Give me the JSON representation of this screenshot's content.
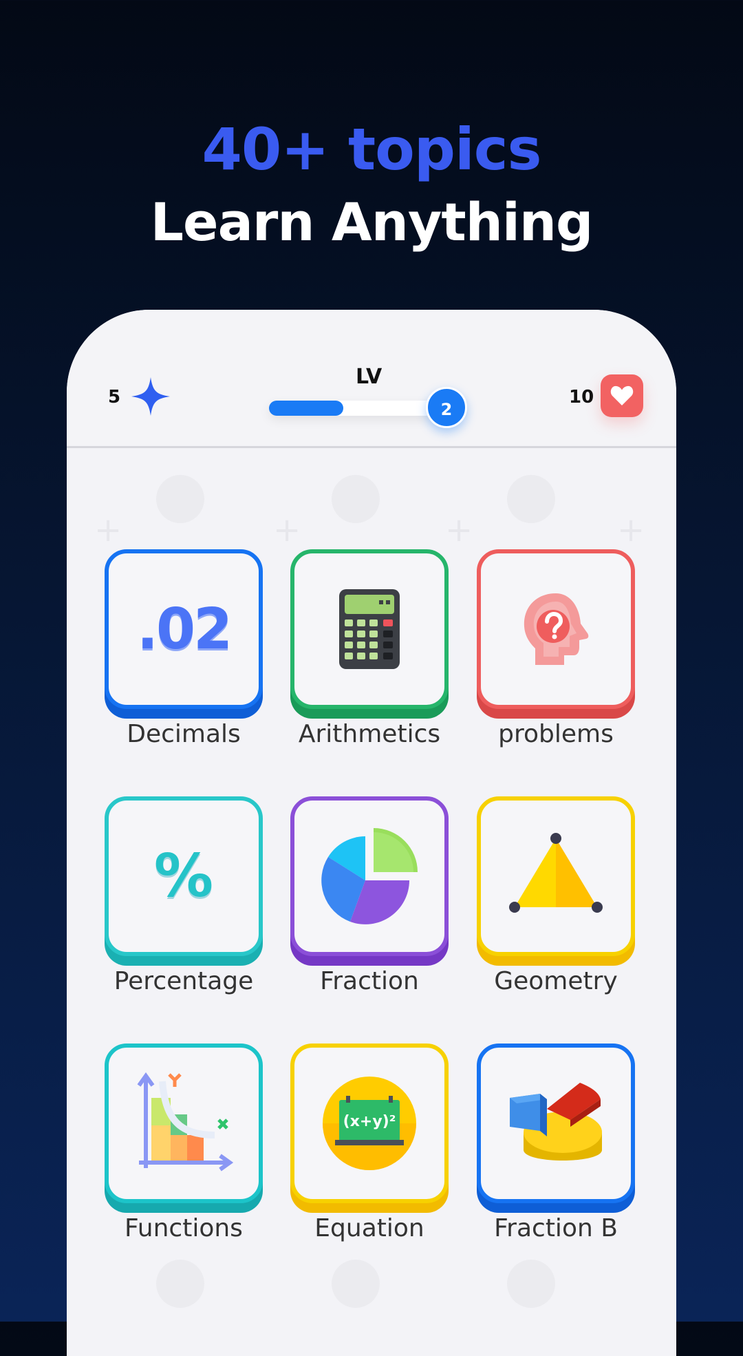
{
  "headline": {
    "title": "40+ topics",
    "subtitle": "Learn Anything"
  },
  "status": {
    "gems": "5",
    "level_label": "LV",
    "level": "2",
    "progress_fraction": 0.45,
    "hearts": "10"
  },
  "colors": {
    "title_blue": "#3a5bf0",
    "progress_blue": "#1a7bf5",
    "heart_red": "#f26262"
  },
  "topics": [
    {
      "label": "Decimals",
      "border": "#1673f2",
      "icon": "decimal-icon",
      "icon_text": ".02"
    },
    {
      "label": "Arithmetics",
      "border": "#26b56b",
      "icon": "calculator-icon"
    },
    {
      "label": "problems",
      "border": "#ee5d5d",
      "icon": "question-head-icon"
    },
    {
      "label": "Percentage",
      "border": "#28c7c9",
      "icon": "percent-icon",
      "icon_text": "%"
    },
    {
      "label": "Fraction",
      "border": "#8b4fd8",
      "icon": "pie-chart-icon"
    },
    {
      "label": "Geometry",
      "border": "#f7d100",
      "icon": "triangle-icon"
    },
    {
      "label": "Functions",
      "border": "#1cc4c9",
      "icon": "graph-icon"
    },
    {
      "label": "Equation",
      "border": "#f7d100",
      "icon": "equation-icon",
      "icon_text": "(x+y)²"
    },
    {
      "label": "Fraction B",
      "border": "#1673f2",
      "icon": "3d-pie-icon"
    }
  ]
}
